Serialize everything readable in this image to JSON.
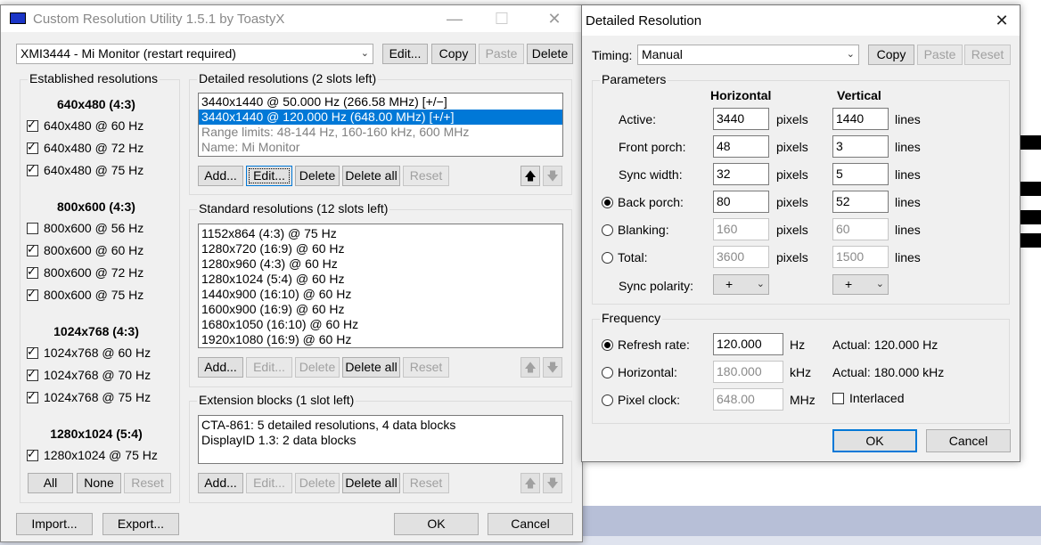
{
  "main": {
    "title": "Custom Resolution Utility 1.5.1 by ToastyX",
    "monitor_select": "XMI3444 - Mi Monitor (restart required)",
    "top_buttons": {
      "edit": "Edit...",
      "copy": "Copy",
      "paste": "Paste",
      "delete": "Delete"
    },
    "established": {
      "label": "Established resolutions",
      "groups": [
        {
          "heading": "640x480 (4:3)",
          "items": [
            {
              "label": "640x480 @ 60 Hz",
              "checked": true
            },
            {
              "label": "640x480 @ 72 Hz",
              "checked": true
            },
            {
              "label": "640x480 @ 75 Hz",
              "checked": true
            }
          ]
        },
        {
          "heading": "800x600 (4:3)",
          "items": [
            {
              "label": "800x600 @ 56 Hz",
              "checked": false
            },
            {
              "label": "800x600 @ 60 Hz",
              "checked": true
            },
            {
              "label": "800x600 @ 72 Hz",
              "checked": true
            },
            {
              "label": "800x600 @ 75 Hz",
              "checked": true
            }
          ]
        },
        {
          "heading": "1024x768 (4:3)",
          "items": [
            {
              "label": "1024x768 @ 60 Hz",
              "checked": true
            },
            {
              "label": "1024x768 @ 70 Hz",
              "checked": true
            },
            {
              "label": "1024x768 @ 75 Hz",
              "checked": true
            }
          ]
        },
        {
          "heading": "1280x1024 (5:4)",
          "items": [
            {
              "label": "1280x1024 @ 75 Hz",
              "checked": true
            }
          ]
        }
      ],
      "buttons": {
        "all": "All",
        "none": "None",
        "reset": "Reset"
      }
    },
    "detailed": {
      "label": "Detailed resolutions (2 slots left)",
      "rows": [
        "3440x1440 @ 50.000 Hz (266.58 MHz) [+/−]",
        "3440x1440 @ 120.000 Hz (648.00 MHz) [+/+]",
        "Range limits: 48-144 Hz, 160-160 kHz, 600 MHz",
        "Name: Mi Monitor"
      ],
      "buttons": {
        "add": "Add...",
        "edit": "Edit...",
        "delete": "Delete",
        "delete_all": "Delete all",
        "reset": "Reset"
      }
    },
    "standard": {
      "label": "Standard resolutions (12 slots left)",
      "rows": [
        "1152x864 (4:3) @ 75 Hz",
        "1280x720 (16:9) @ 60 Hz",
        "1280x960 (4:3) @ 60 Hz",
        "1280x1024 (5:4) @ 60 Hz",
        "1440x900 (16:10) @ 60 Hz",
        "1600x900 (16:9) @ 60 Hz",
        "1680x1050 (16:10) @ 60 Hz",
        "1920x1080 (16:9) @ 60 Hz"
      ],
      "buttons": {
        "add": "Add...",
        "edit": "Edit...",
        "delete": "Delete",
        "delete_all": "Delete all",
        "reset": "Reset"
      }
    },
    "extension": {
      "label": "Extension blocks (1 slot left)",
      "rows": [
        "CTA-861: 5 detailed resolutions, 4 data blocks",
        "DisplayID 1.3: 2 data blocks"
      ],
      "buttons": {
        "add": "Add...",
        "edit": "Edit...",
        "delete": "Delete",
        "delete_all": "Delete all",
        "reset": "Reset"
      }
    },
    "bottom_buttons": {
      "import": "Import...",
      "export": "Export...",
      "ok": "OK",
      "cancel": "Cancel"
    }
  },
  "detail": {
    "title": "Detailed Resolution",
    "timing_label": "Timing:",
    "timing_value": "Manual",
    "buttons": {
      "copy": "Copy",
      "paste": "Paste",
      "reset": "Reset"
    },
    "params_label": "Parameters",
    "col_h": "Horizontal",
    "col_v": "Vertical",
    "rows": [
      {
        "label": "Active:",
        "h": "3440",
        "v": "1440",
        "radio": false,
        "enabled": true
      },
      {
        "label": "Front porch:",
        "h": "48",
        "v": "3",
        "radio": false,
        "enabled": true
      },
      {
        "label": "Sync width:",
        "h": "32",
        "v": "5",
        "radio": false,
        "enabled": true
      },
      {
        "label": "Back porch:",
        "h": "80",
        "v": "52",
        "radio": true,
        "selected": true,
        "enabled": true
      },
      {
        "label": "Blanking:",
        "h": "160",
        "v": "60",
        "radio": true,
        "selected": false,
        "enabled": false
      },
      {
        "label": "Total:",
        "h": "3600",
        "v": "1500",
        "radio": true,
        "selected": false,
        "enabled": false
      }
    ],
    "unit_h": "pixels",
    "unit_v": "lines",
    "sync_polarity_label": "Sync polarity:",
    "sync_h": "+",
    "sync_v": "+",
    "freq_label": "Frequency",
    "freq_rows": [
      {
        "label": "Refresh rate:",
        "value": "120.000",
        "unit": "Hz",
        "actual": "Actual: 120.000 Hz",
        "selected": true,
        "enabled": true
      },
      {
        "label": "Horizontal:",
        "value": "180.000",
        "unit": "kHz",
        "actual": "Actual: 180.000 kHz",
        "selected": false,
        "enabled": false
      },
      {
        "label": "Pixel clock:",
        "value": "648.00",
        "unit": "MHz",
        "actual": "",
        "selected": false,
        "enabled": false
      }
    ],
    "interlaced": "Interlaced",
    "ok": "OK",
    "cancel": "Cancel"
  }
}
